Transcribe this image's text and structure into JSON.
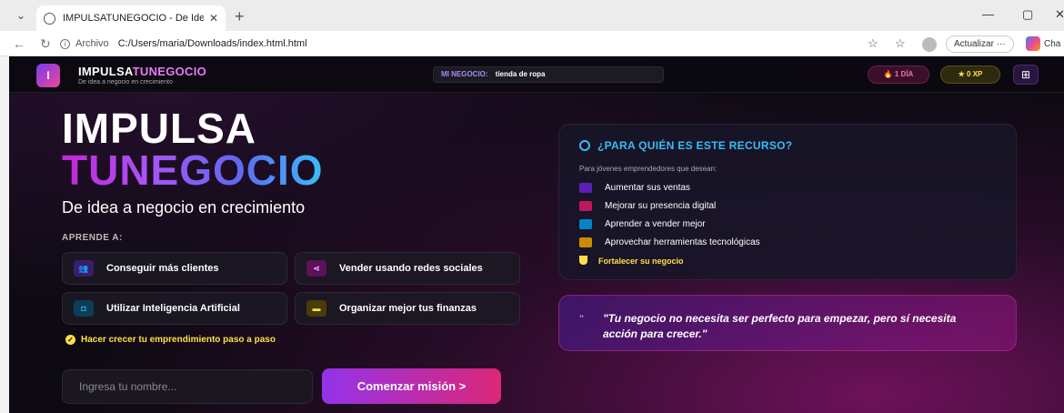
{
  "browser": {
    "tab_title": "IMPULSATUNEGOCIO - De Idea a |",
    "tab_close": "✕",
    "new_tab": "+",
    "url_label": "Archivo",
    "url": "C:/Users/maria/Downloads/index.html.html",
    "update_label": "Actualizar ···",
    "copilot_label": "Cha",
    "minimize": "—",
    "restore": "▢",
    "close": "✕"
  },
  "header": {
    "logo_letter": "I",
    "brand_part1": "IMPULSA",
    "brand_part2": "TUNEGOCIO",
    "tagline": "De idea a negocio en crecimiento",
    "business_label": "MI NEGOCIO:",
    "business_value": "tienda de ropa",
    "days": "1 DÍA",
    "xp": "0 XP"
  },
  "hero": {
    "line1": "IMPULSA",
    "line2": "TUNEGOCIO",
    "subtitle": "De idea a negocio en crecimiento",
    "learn_label": "APRENDE A:",
    "cards": [
      {
        "label": "Conseguir más clientes",
        "icon": "people-icon",
        "color": "#7c3aed"
      },
      {
        "label": "Vender usando redes sociales",
        "icon": "share-icon",
        "color": "#c026d3"
      },
      {
        "label": "Utilizar Inteligencia Artificial",
        "icon": "robot-icon",
        "color": "#0ea5e9"
      },
      {
        "label": "Organizar mejor tus finanzas",
        "icon": "wallet-icon",
        "color": "#eab308"
      }
    ],
    "growth_text": "Hacer crecer tu emprendimiento paso a paso",
    "name_placeholder": "Ingresa tu nombre...",
    "start_button": "Comenzar misión >"
  },
  "audience": {
    "title": "¿PARA QUIÉN ES ESTE RECURSO?",
    "intro": "Para jóvenes emprendedores que desean:",
    "items": [
      {
        "label": "Aumentar sus ventas",
        "color": "#6d28d9"
      },
      {
        "label": "Mejorar su presencia digital",
        "color": "#db2777"
      },
      {
        "label": "Aprender a vender mejor",
        "color": "#0ea5e9"
      },
      {
        "label": "Aprovechar herramientas tecnológicas",
        "color": "#eab308"
      }
    ],
    "highlight": "Fortalecer su negocio"
  },
  "quote": {
    "mark": "“",
    "text": "\"Tu negocio no necesita ser perfecto para empezar, pero sí necesita acción para crecer.\""
  }
}
